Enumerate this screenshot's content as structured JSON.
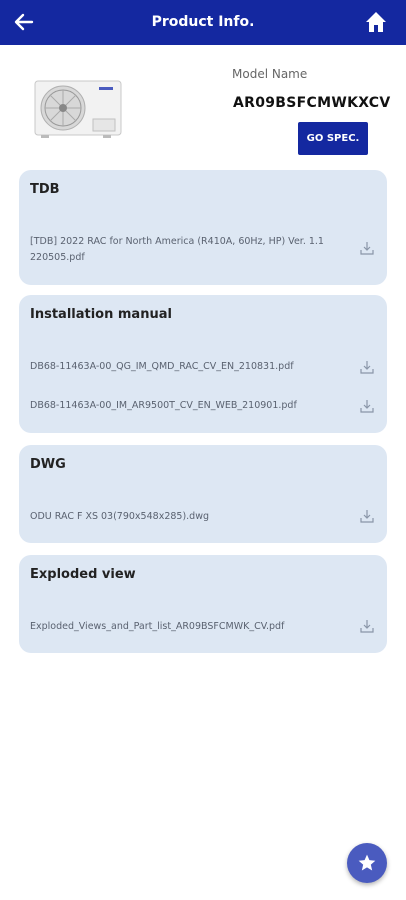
{
  "header": {
    "title": "Product Info."
  },
  "product": {
    "model_label": "Model Name",
    "model_name": "AR09BSFCMWKXCV",
    "spec_button": "GO SPEC."
  },
  "sections": [
    {
      "title": "TDB",
      "files": [
        "[TDB] 2022 RAC for North America (R410A, 60Hz, HP) Ver. 1.1 220505.pdf"
      ]
    },
    {
      "title": "Installation manual",
      "files": [
        "DB68-11463A-00_QG_IM_QMD_RAC_CV_EN_210831.pdf",
        "DB68-11463A-00_IM_AR9500T_CV_EN_WEB_210901.pdf"
      ]
    },
    {
      "title": "DWG",
      "files": [
        "ODU RAC F XS 03(790x548x285).dwg"
      ]
    },
    {
      "title": "Exploded view",
      "files": [
        "Exploded_Views_and_Part_list_AR09BSFCMWK_CV.pdf"
      ]
    }
  ],
  "icons": {
    "back": "arrow-left-icon",
    "home": "home-icon",
    "download": "download-icon",
    "favorite": "star-icon"
  },
  "colors": {
    "header": "#1428a0",
    "card": "#dde7f3",
    "fab": "#4a5bbf"
  }
}
